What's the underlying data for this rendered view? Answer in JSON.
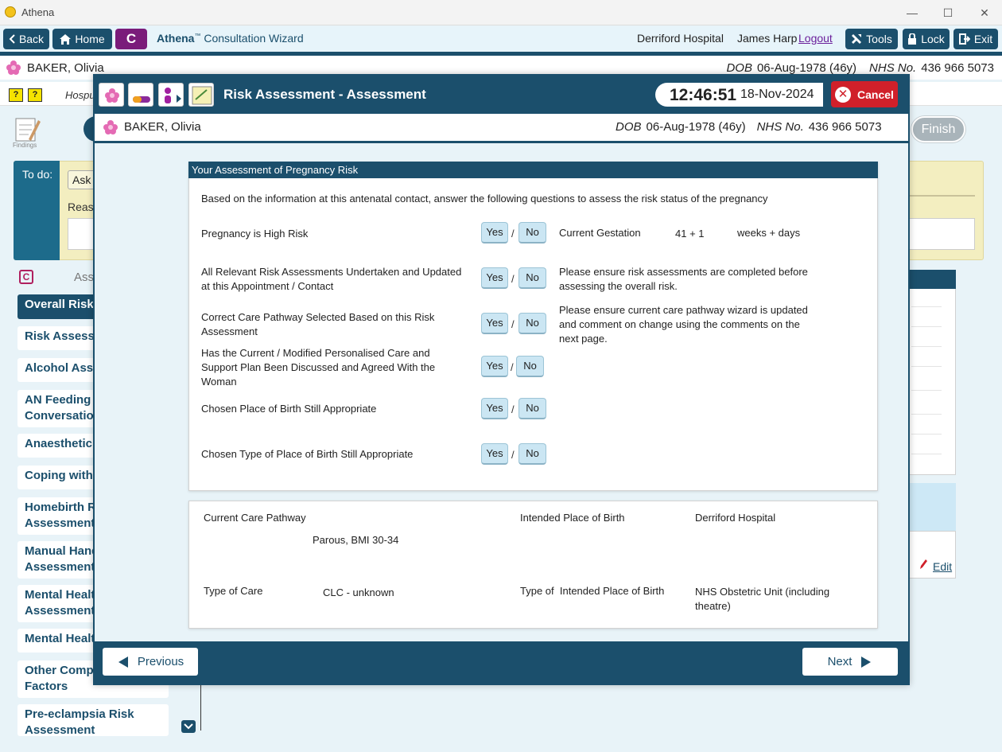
{
  "window": {
    "title": "Athena",
    "minimize": "—",
    "maximize": "☐",
    "close": "✕"
  },
  "nav": {
    "back": "Back",
    "home": "Home",
    "c_label": "C",
    "brand_name": "Athena",
    "brand_tm": "™",
    "brand_rest": " Consultation Wizard",
    "hospital": "Derriford Hospital",
    "user": "James Harp",
    "logout": "Logout",
    "tools": "Tools",
    "lock": "Lock",
    "exit": "Exit"
  },
  "patient": {
    "name": "BAKER, Olivia",
    "dob_label": "DOB",
    "dob": "06-Aug-1978 (46y)",
    "nhs_label": "NHS No.",
    "nhs": "436 966 5073"
  },
  "background": {
    "hosp_partial": "Hospu",
    "findings": "Findings",
    "finish": "Finish",
    "todo_label": "To do:",
    "ask": "Ask",
    "reason": "Reas",
    "c_mini": "C",
    "ass_label": "Ass",
    "edit": "Edit",
    "sidebar": [
      "Overall Risk",
      "Risk Assessm",
      "Alcohol Asse",
      "AN Feeding\nConversation",
      "Anaesthetic",
      "Coping with",
      "Homebirth R\nAssessment",
      "Manual Hand\nAssessment",
      "Mental Healt\nAssessment",
      "Mental Healt",
      "Other Comp\nFactors",
      "Pre-eclampsia Risk\nAssessment"
    ]
  },
  "modal": {
    "title": "Risk Assessment - Assessment",
    "time": "12:46:51",
    "date": "18-Nov-2024",
    "cancel": "Cancel",
    "card_title": "Your Assessment of Pregnancy Risk",
    "intro": "Based on the information at this antenatal contact, answer the following questions to assess the risk status of the pregnancy",
    "yes": "Yes",
    "no": "No",
    "slash": "/",
    "questions": [
      "Pregnancy is High Risk",
      "All Relevant Risk Assessments Undertaken and Updated at this Appointment / Contact",
      "Correct Care Pathway Selected Based on this Risk Assessment",
      "Has the Current / Modified Personalised Care and Support Plan Been Discussed and Agreed With the Woman",
      "Chosen Place of Birth Still Appropriate",
      "Chosen Type of Place of Birth Still Appropriate"
    ],
    "gestation_label": "Current Gestation",
    "gestation_value": "41 + 1",
    "gestation_unit": "weeks + days",
    "note_risk": "Please ensure risk assessments are completed before assessing the overall risk.",
    "note_pathway": "Please ensure current care pathway wizard is updated and comment on change using the comments on the next page.",
    "summary": {
      "pathway_label": "Current Care Pathway",
      "pathway_value": "Parous, BMI 30-34",
      "place_label": "Intended Place of Birth",
      "place_value": "Derriford Hospital",
      "care_label": "Type of Care",
      "care_value": "CLC - unknown",
      "place_type_label": "Type of  Intended Place of Birth",
      "place_type_value": "NHS Obstetric Unit (including theatre)"
    },
    "previous": "Previous",
    "next": "Next"
  },
  "colors": {
    "primary": "#1b4f6c",
    "cancel": "#d0202a",
    "brand_c": "#7a1c7a",
    "yn_button": "#cbe6f3",
    "todo_bg": "#f3eec0"
  },
  "icons": [
    "athena-logo-icon",
    "back-arrow-icon",
    "home-icon",
    "tools-icon",
    "lock-icon",
    "exit-icon",
    "flower-icon",
    "pills-icon",
    "figure-icon",
    "notes-icon",
    "cancel-x-icon",
    "arrow-left-icon",
    "arrow-right-icon"
  ]
}
